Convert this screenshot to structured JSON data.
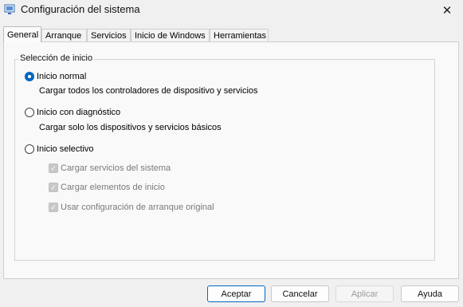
{
  "window": {
    "title": "Configuración del sistema",
    "close_glyph": "✕"
  },
  "tabs": [
    {
      "label": "General",
      "active": true
    },
    {
      "label": "Arranque",
      "active": false
    },
    {
      "label": "Servicios",
      "active": false
    },
    {
      "label": "Inicio de Windows",
      "active": false
    },
    {
      "label": "Herramientas",
      "active": false
    }
  ],
  "general": {
    "group_label": "Selección de inicio",
    "options": [
      {
        "label": "Inicio normal",
        "checked": true,
        "description": "Cargar todos los controladores de dispositivo y servicios"
      },
      {
        "label": "Inicio con diagnóstico",
        "checked": false,
        "description": "Cargar solo los dispositivos y servicios básicos"
      },
      {
        "label": "Inicio selectivo",
        "checked": false,
        "description": ""
      }
    ],
    "selective_items": [
      {
        "label": "Cargar servicios del sistema",
        "checked": true,
        "enabled": false
      },
      {
        "label": "Cargar elementos de inicio",
        "checked": true,
        "enabled": false
      },
      {
        "label": "Usar configuración de arranque original",
        "checked": true,
        "enabled": false
      }
    ]
  },
  "buttons": {
    "accept": "Aceptar",
    "cancel": "Cancelar",
    "apply": "Aplicar",
    "help": "Ayuda"
  },
  "colors": {
    "accent": "#0067c0",
    "disabled_text": "#7a7a7a"
  }
}
